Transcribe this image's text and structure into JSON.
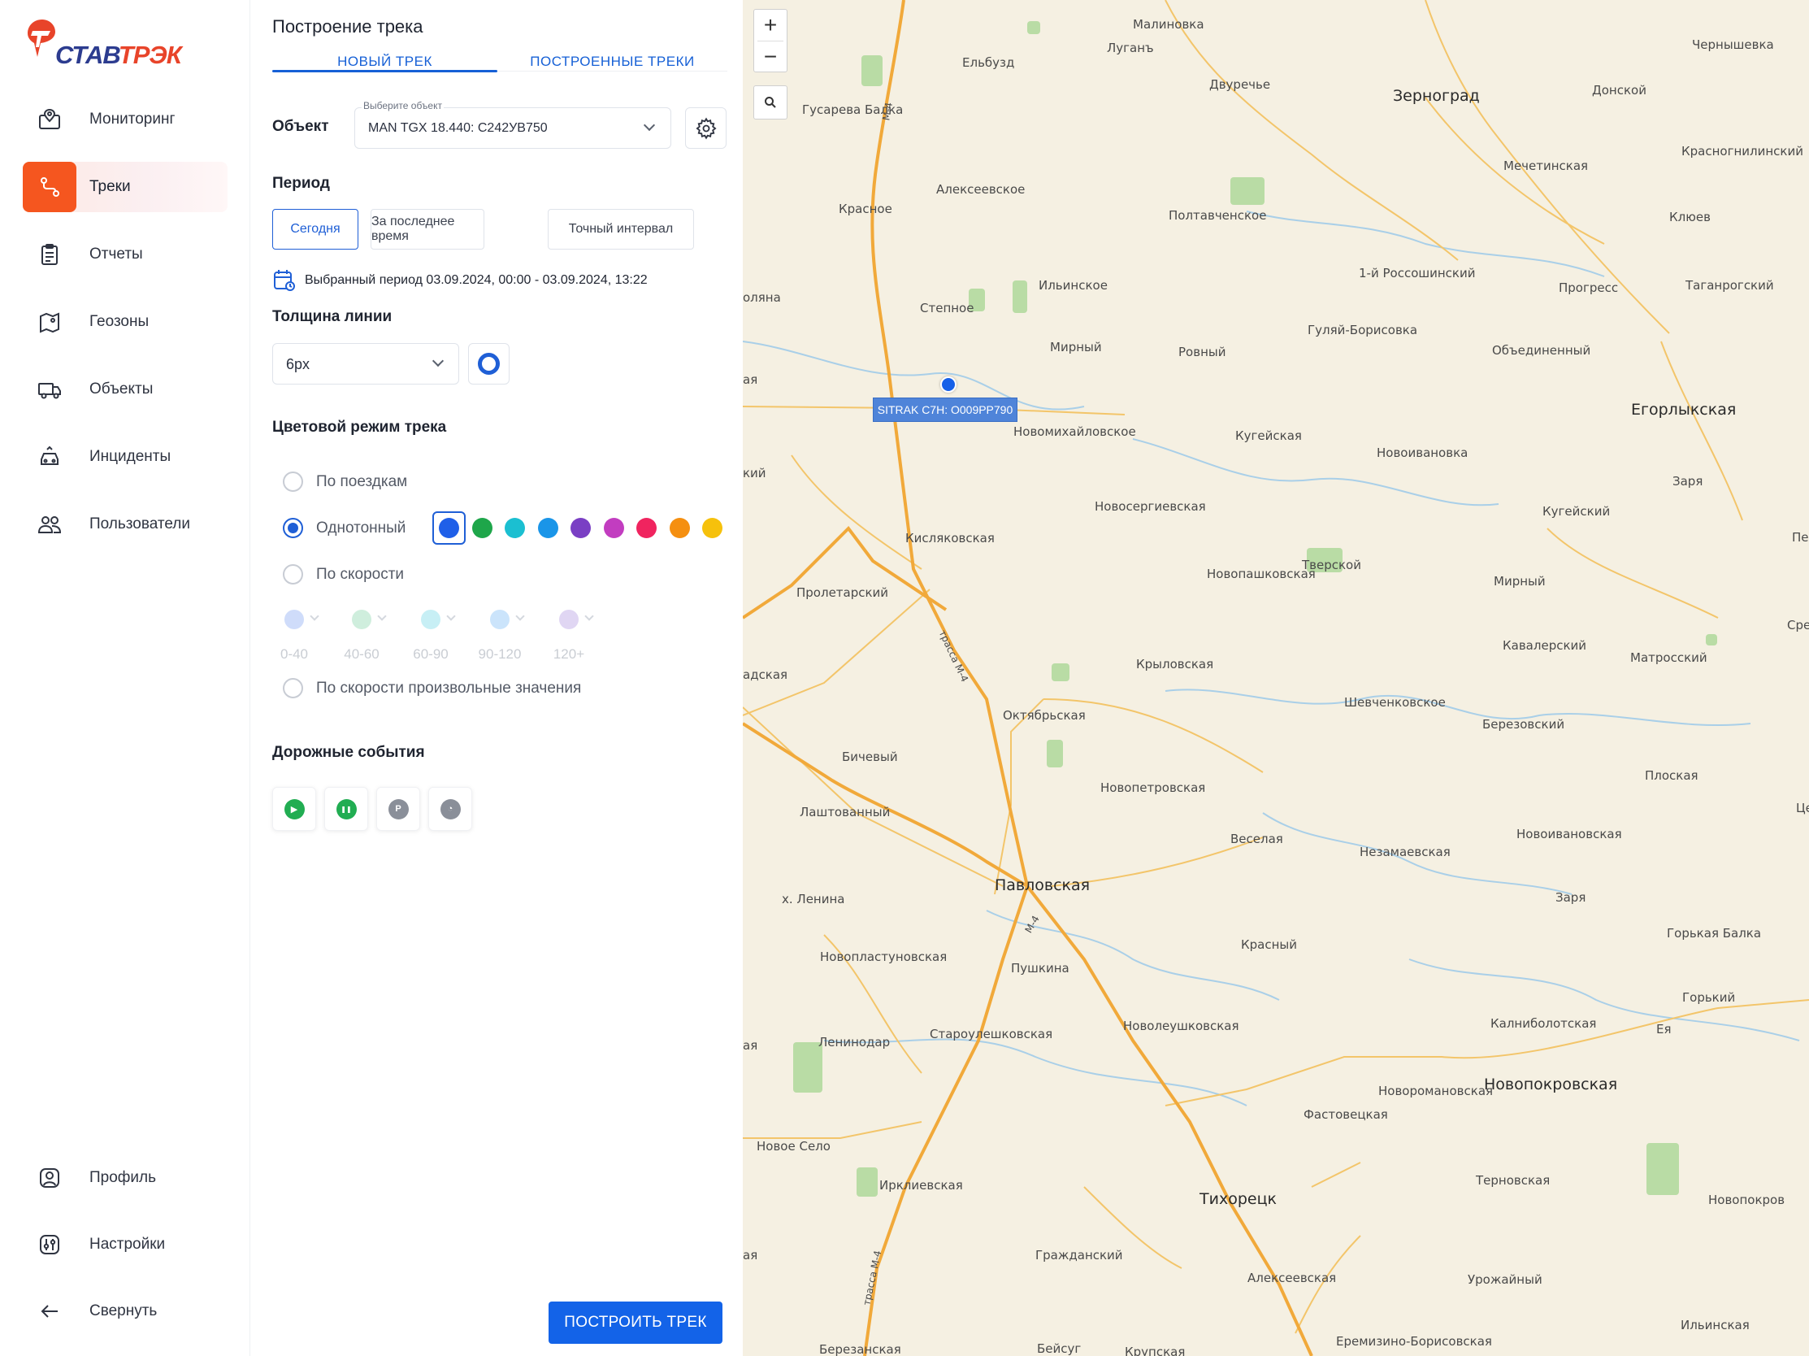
{
  "brand": {
    "logo_text_a": "СТАВ",
    "logo_text_b": "ТРЭК",
    "accent": "#f5561f",
    "blue": "#1363e8"
  },
  "sidebar": {
    "items": [
      {
        "label": "Мониторинг",
        "icon": "monitor-map-icon"
      },
      {
        "label": "Треки",
        "icon": "route-icon",
        "active": true
      },
      {
        "label": "Отчеты",
        "icon": "report-icon"
      },
      {
        "label": "Геозоны",
        "icon": "geozone-icon"
      },
      {
        "label": "Объекты",
        "icon": "truck-icon"
      },
      {
        "label": "Инциденты",
        "icon": "incident-car-icon"
      },
      {
        "label": "Пользователи",
        "icon": "users-icon"
      }
    ],
    "bottom": [
      {
        "label": "Профиль",
        "icon": "profile-icon"
      },
      {
        "label": "Настройки",
        "icon": "settings-icon"
      },
      {
        "label": "Свернуть",
        "icon": "arrow-left-icon"
      }
    ]
  },
  "panel": {
    "title": "Построение трека",
    "tabs": [
      {
        "label": "НОВЫЙ ТРЕК",
        "active": true
      },
      {
        "label": "ПОСТРОЕННЫЕ ТРЕКИ"
      }
    ],
    "object_label": "Объект",
    "object_select": {
      "floating_label": "Выберите объект",
      "value": "MAN TGX 18.440: С242УВ750"
    },
    "period_label": "Период",
    "period_buttons": [
      {
        "label": "Сегодня",
        "active": true
      },
      {
        "label": "За последнее время"
      },
      {
        "label": "Точный интервал"
      }
    ],
    "period_info": "Выбранный период 03.09.2024, 00:00 - 03.09.2024, 13:22",
    "line_width_label": "Толщина линии",
    "line_width_value": "6px",
    "color_mode_label": "Цветовой режим трека",
    "color_modes": [
      {
        "label": "По поездкам",
        "checked": false
      },
      {
        "label": "Однотонный",
        "checked": true
      },
      {
        "label": "По скорости",
        "checked": false
      },
      {
        "label": "По скорости произвольные значения",
        "checked": false
      }
    ],
    "swatches": [
      "#1f5fe8",
      "#1ea64a",
      "#1bbfd1",
      "#1a95e8",
      "#7a3fc4",
      "#c23dc0",
      "#f0245f",
      "#f58f10",
      "#f6c10c"
    ],
    "speed_ranges": [
      {
        "label": "0-40",
        "color": "#cfdcfa"
      },
      {
        "label": "40-60",
        "color": "#cfeedd"
      },
      {
        "label": "60-90",
        "color": "#c7eff5"
      },
      {
        "label": "90-120",
        "color": "#cbe4fb"
      },
      {
        "label": "120+",
        "color": "#e0d6f3"
      }
    ],
    "road_events_label": "Дорожные события",
    "road_events": [
      {
        "icon": "play-icon",
        "glyph": "▶",
        "color": "#21ad52"
      },
      {
        "icon": "pause-icon",
        "glyph": "❚❚",
        "color": "#21ad52"
      },
      {
        "icon": "parking-icon",
        "glyph": "P",
        "color": "#8a8f99"
      },
      {
        "icon": "speedometer-icon",
        "glyph": "◔",
        "color": "#8a8f99"
      }
    ],
    "build_button": "ПОСТРОИТЬ ТРЕК"
  },
  "map": {
    "zoom_in": "+",
    "zoom_out": "−",
    "vehicle_label": "SITRAK C7H: О009РР790",
    "places": [
      {
        "name": "Малиновка"
      },
      {
        "name": "Чернышевка"
      },
      {
        "name": "Ельбузд"
      },
      {
        "name": "Луганъ"
      },
      {
        "name": "Двуречье"
      },
      {
        "name": "Зерноград",
        "big": true
      },
      {
        "name": "Донской"
      },
      {
        "name": "Гусарева Балка"
      },
      {
        "name": "Красногнилинский"
      },
      {
        "name": "Мечетинская"
      },
      {
        "name": "Алексеевское"
      },
      {
        "name": "Красное"
      },
      {
        "name": "Полтавченское"
      },
      {
        "name": "Клюев"
      },
      {
        "name": "Ильинское"
      },
      {
        "name": "1-й Россошинский"
      },
      {
        "name": "Прогресс"
      },
      {
        "name": "Таганрогский"
      },
      {
        "name": "Степное"
      },
      {
        "name": "Гуляй-Борисовка"
      },
      {
        "name": "Мирный"
      },
      {
        "name": "Ровный"
      },
      {
        "name": "Объединенный"
      },
      {
        "name": "Егорлыкская",
        "big": true
      },
      {
        "name": "Новомихайловское"
      },
      {
        "name": "Кугейская"
      },
      {
        "name": "Новоивановка"
      },
      {
        "name": "Заря"
      },
      {
        "name": "Новосергиевская"
      },
      {
        "name": "Кугейский"
      },
      {
        "name": "Кисляковская"
      },
      {
        "name": "Новопашковская"
      },
      {
        "name": "Тверской"
      },
      {
        "name": "Мирный"
      },
      {
        "name": "Пролетарский"
      },
      {
        "name": "Кавалерский"
      },
      {
        "name": "Матросский"
      },
      {
        "name": "Крыловская"
      },
      {
        "name": "Шевченковское"
      },
      {
        "name": "Березовский"
      },
      {
        "name": "Октябрьская"
      },
      {
        "name": "Бичевый"
      },
      {
        "name": "Новопетровская"
      },
      {
        "name": "Плоская"
      },
      {
        "name": "Лаштованный"
      },
      {
        "name": "Веселая"
      },
      {
        "name": "Незамаевская"
      },
      {
        "name": "Новоивановская"
      },
      {
        "name": "Павловская",
        "big": true
      },
      {
        "name": "х. Ленина"
      },
      {
        "name": "Заря"
      },
      {
        "name": "Горькая Балка"
      },
      {
        "name": "Новопластуновская"
      },
      {
        "name": "Красный"
      },
      {
        "name": "Пушкина"
      },
      {
        "name": "Горький"
      },
      {
        "name": "Калниболотская"
      },
      {
        "name": "Ленинодар"
      },
      {
        "name": "Староулешковская"
      },
      {
        "name": "Новолеушковская"
      },
      {
        "name": "Ея"
      },
      {
        "name": "Новоромановская"
      },
      {
        "name": "Новопокровская",
        "big": true
      },
      {
        "name": "Фастовецкая"
      },
      {
        "name": "Новое Село"
      },
      {
        "name": "Ирклиевская"
      },
      {
        "name": "Тихорецк",
        "big": true
      },
      {
        "name": "Терновская"
      },
      {
        "name": "Новопокров"
      },
      {
        "name": "Гражданский"
      },
      {
        "name": "Алексеевская"
      },
      {
        "name": "Урожайный"
      },
      {
        "name": "Ильинская"
      },
      {
        "name": "Березанская"
      },
      {
        "name": "Бейсуг"
      },
      {
        "name": "Крупская"
      },
      {
        "name": "Еремизино-Борисовская"
      },
      {
        "name": "адская"
      },
      {
        "name": "оляна"
      },
      {
        "name": "кий"
      },
      {
        "name": "Пер"
      },
      {
        "name": "Средни"
      },
      {
        "name": "Це"
      },
      {
        "name": "ая"
      },
      {
        "name": "ая"
      },
      {
        "name": "ая"
      }
    ],
    "road_labels": [
      "М-4",
      "трасса М-4",
      "М-4",
      "трасса М-4"
    ]
  }
}
